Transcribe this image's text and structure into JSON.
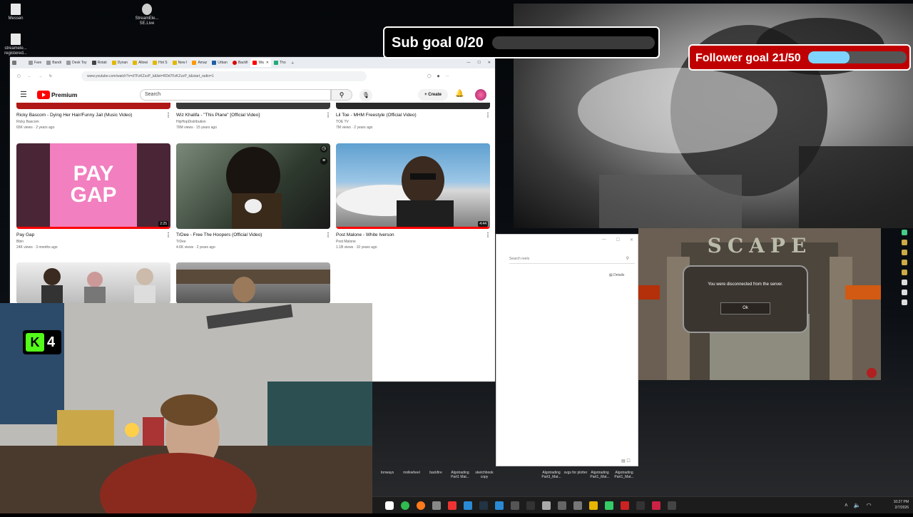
{
  "desktop": {
    "icons": [
      {
        "label": "Messen"
      },
      {
        "label": "StreamEle... SE.Live"
      },
      {
        "label": "streamele... registered..."
      }
    ],
    "taskbar_files": [
      "tonways",
      "molkwheel",
      "backfire",
      "Algotrading Part1 Mat...",
      "sketchbook copy",
      "Algotrading Part3_Mat...",
      "svgs for plotter",
      "Algotrading Part1_Mat...",
      "Algotrading Part1_Mat..."
    ],
    "clock_time": "10:27 PM",
    "clock_date": "2/7/2026"
  },
  "browser": {
    "tabs": [
      "Fare",
      "Bandi",
      "Desk Toy",
      "Rotati",
      "Dynan",
      "Allowi",
      "Hot S",
      "New I",
      "Amaz",
      "Urban",
      "Backfi",
      "Wa",
      "Tho"
    ],
    "url": "www.youtube.com/watch?v=d7FzKZzzP_k&list=RDd7FzKZzzP_k&start_radio=1",
    "youtube": {
      "logo_text": "Premium",
      "search_placeholder": "Search",
      "create_label": "Create",
      "videos": [
        {
          "title": "Ricky Bascom - Dying Her Hair/Funny Jail (Music Video)",
          "channel": "Ricky Bascom",
          "meta": "65K views · 2 years ago"
        },
        {
          "title": "Wiz Khalifa - \"This Plane\" [Official Video]",
          "channel": "HipHopDistribution",
          "meta": "76M views · 15 years ago"
        },
        {
          "title": "Lil Toe - MHM Freestyle (Official Video)",
          "channel": "TOE TV",
          "meta": "7M views · 2 years ago"
        },
        {
          "title": "Pay Gap",
          "channel": "Bbin",
          "meta": "24K views · 3 months ago",
          "duration": "2:25",
          "thumb_text": "PAY GAP"
        },
        {
          "title": "TrDee - Free The Hoopers (Official Video)",
          "channel": "TrDee",
          "meta": "4.6K views · 2 years ago",
          "duration": ""
        },
        {
          "title": "Post Malone - White Iverson",
          "channel": "Post Malone",
          "meta": "1.1B views · 10 years ago",
          "duration": "4:44"
        }
      ]
    }
  },
  "overlays": {
    "sub_goal": "Sub goal 0/20",
    "sub_goal_progress": 0.0,
    "follower_goal": "Follower goal 21/50",
    "follower_goal_progress": 0.42,
    "kick_viewers": "4"
  },
  "reels_window": {
    "search_placeholder": "Search reels",
    "details_label": "Details"
  },
  "game": {
    "logo": "SCAPE",
    "message": "You were disconnected from the server.",
    "ok_label": "Ok"
  }
}
